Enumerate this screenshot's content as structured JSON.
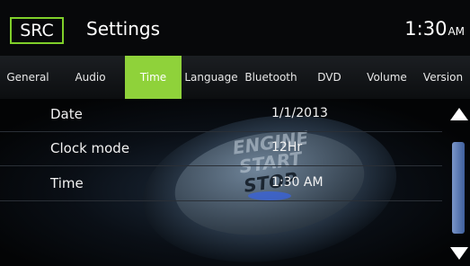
{
  "header": {
    "src_label": "SRC",
    "title": "Settings",
    "time": "1:30",
    "ampm": "AM"
  },
  "tabs": [
    {
      "label": "General"
    },
    {
      "label": "Audio"
    },
    {
      "label": "Time",
      "active": true
    },
    {
      "label": "Language"
    },
    {
      "label": "Bluetooth"
    },
    {
      "label": "DVD"
    },
    {
      "label": "Volume"
    },
    {
      "label": "Version"
    }
  ],
  "settings": [
    {
      "label": "Date",
      "value": "1/1/2013"
    },
    {
      "label": "Clock mode",
      "value": "12Hr"
    },
    {
      "label": "Time",
      "value": "1:30 AM"
    }
  ],
  "background_art": {
    "line1": "ENGINE",
    "line2": "START",
    "line3": "STOP"
  },
  "colors": {
    "accent": "#8fd23a",
    "background": "#050607",
    "scrollbar": "#5f7fb8"
  },
  "icons": {
    "scroll_up": "triangle-up-icon",
    "scroll_down": "triangle-down-icon"
  }
}
